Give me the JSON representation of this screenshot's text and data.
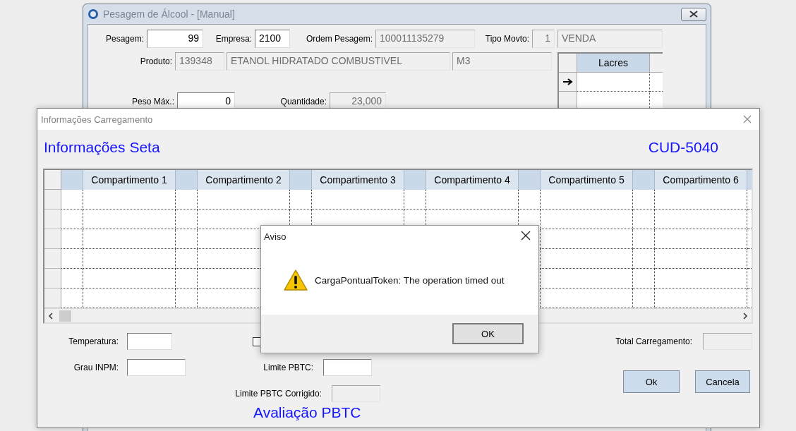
{
  "main_window": {
    "title": "Pesagem de Álcool - [Manual]",
    "form_lines": [
      {
        "items": [
          {
            "kind": "label",
            "text": "Pesagem:"
          },
          {
            "kind": "number_field",
            "value": "99",
            "disabled": false
          },
          {
            "kind": "label",
            "text": "Empresa:"
          },
          {
            "kind": "field",
            "value": "2100",
            "disabled": false
          },
          {
            "kind": "label",
            "text": "Ordem Pesagem:"
          },
          {
            "kind": "field",
            "value": "100011135279",
            "disabled": true
          },
          {
            "kind": "label",
            "text": "Tipo Movto:"
          },
          {
            "kind": "number_field",
            "value": "1",
            "disabled": true
          },
          {
            "kind": "field",
            "value": "VENDA",
            "disabled": true
          }
        ]
      },
      {
        "items": [
          {
            "kind": "label",
            "text": "Produto:"
          },
          {
            "kind": "field",
            "value": "139348",
            "disabled": true
          },
          {
            "kind": "field",
            "value": "ETANOL HIDRATADO COMBUSTIVEL",
            "disabled": true
          },
          {
            "kind": "field",
            "value": "M3",
            "disabled": true
          }
        ]
      },
      {
        "items": [
          {
            "kind": "label",
            "text": "Peso Máx.:"
          },
          {
            "kind": "number_field",
            "value": "0",
            "disabled": false
          },
          {
            "kind": "label",
            "text": "Quantidade:"
          },
          {
            "kind": "number_field",
            "value": "23,000",
            "disabled": true
          }
        ]
      }
    ],
    "lacres_grid": {
      "column": "Lacres",
      "rows": [
        {
          "selected": true
        },
        {
          "selected": false
        }
      ]
    }
  },
  "dialog": {
    "title": "Informações Carregamento",
    "heading": "Informações Seta",
    "code": "CUD-5040",
    "grid": {
      "columns": [
        "Compartimento 1",
        "Compartimento 2",
        "Compartimento 3",
        "Compartimento 4",
        "Compartimento 5",
        "Compartimento 6"
      ]
    },
    "temperature": {
      "label": "Temperatura:",
      "disabled": false
    },
    "checkbox": {
      "checked": false
    },
    "total": {
      "label": "Total Carregamento:",
      "disabled": true
    },
    "grau": {
      "label": "Grau INPM:",
      "disabled": false
    },
    "limite": {
      "label": "Limite PBTC:",
      "disabled": false
    },
    "limite_corrigido": {
      "label": "Limite PBTC Corrigido:",
      "disabled": true
    },
    "section_title": "Avaliação PBTC",
    "buttons": [
      {
        "label": "Ok"
      },
      {
        "label": "Cancela"
      }
    ]
  },
  "alert": {
    "title": "Aviso",
    "message": "CargaPontualToken: The operation timed out",
    "button": "OK"
  }
}
